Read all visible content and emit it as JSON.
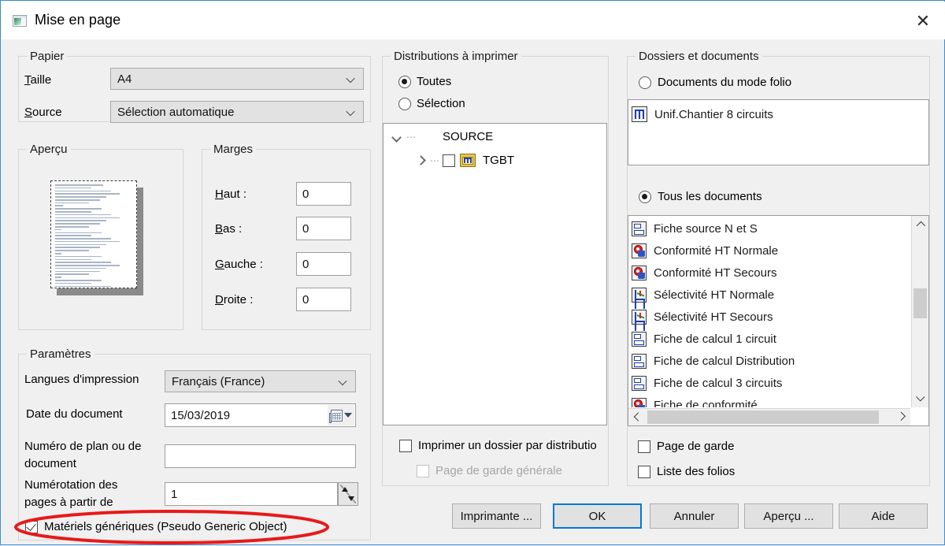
{
  "window": {
    "title": "Mise en page",
    "icon": "page-setup-icon",
    "close_label": "✕",
    "accent": "#0078d7",
    "annotation_color": "#e81919"
  },
  "papier": {
    "legend": "Papier",
    "taille_label": "Taille",
    "taille_label_accel": "T",
    "taille_value": "A4",
    "source_label": "Source",
    "source_label_accel": "S",
    "source_value": "Sélection automatique"
  },
  "apercu": {
    "legend": "Aperçu"
  },
  "marges": {
    "legend": "Marges",
    "fields": [
      {
        "label": "Haut :",
        "accel": "H",
        "value": "0"
      },
      {
        "label": "Bas :",
        "accel": "B",
        "value": "0"
      },
      {
        "label": "Gauche :",
        "accel": "G",
        "value": "0"
      },
      {
        "label": "Droite :",
        "accel": "D",
        "value": "0"
      }
    ]
  },
  "parametres": {
    "legend": "Paramètres",
    "langues_label": "Langues d'impression",
    "langues_value": "Français (France)",
    "date_label": "Date du document",
    "date_value": "15/03/2019",
    "numero_label_line1": "Numéro de plan ou de",
    "numero_label_line2": "document",
    "numero_value": "",
    "numerotation_label_line1": "Numérotation des",
    "numerotation_label_line2": "pages à partir de",
    "numerotation_value": "1",
    "materiels_label": "Matériels génériques (Pseudo Generic Object)",
    "materiels_checked": true
  },
  "distributions": {
    "legend": "Distributions à imprimer",
    "radio_toutes": "Toutes",
    "radio_selection": "Sélection",
    "selected": "Toutes",
    "tree": [
      {
        "label": "SOURCE",
        "level": 0,
        "expanded": true,
        "has_checkbox": false,
        "icon": "none"
      },
      {
        "label": "TGBT",
        "level": 1,
        "expanded": false,
        "has_checkbox": true,
        "checked": false,
        "icon": "switchboard-folder-icon"
      }
    ],
    "imprimer_dossier_label": "Imprimer un dossier par distributio",
    "imprimer_dossier_checked": false,
    "page_garde_generale_label": "Page de garde générale",
    "page_garde_generale_checked": false,
    "page_garde_generale_disabled": true
  },
  "dossiers": {
    "legend": "Dossiers et documents",
    "radio_folio": "Documents du mode folio",
    "radio_tous": "Tous les documents",
    "selected": "Tous les documents",
    "folio_items": [
      {
        "label": "Unif.Chantier 8 circuits",
        "icon": "folio-doc-icon"
      }
    ],
    "documents": [
      {
        "label": "Fiche source N et S",
        "icon": "fiche-calcul-icon"
      },
      {
        "label": "Conformité HT Normale",
        "icon": "conformite-icon"
      },
      {
        "label": "Conformité HT Secours",
        "icon": "conformite-icon"
      },
      {
        "label": "Sélectivité HT Normale",
        "icon": "selectivite-icon"
      },
      {
        "label": "Sélectivité HT Secours",
        "icon": "selectivite-icon"
      },
      {
        "label": "Fiche de calcul 1 circuit",
        "icon": "fiche-calcul-icon"
      },
      {
        "label": "Fiche de calcul Distribution",
        "icon": "fiche-calcul-icon"
      },
      {
        "label": "Fiche de calcul 3 circuits",
        "icon": "fiche-calcul-icon"
      },
      {
        "label": "Fiche de conformité",
        "icon": "conformite-icon"
      }
    ],
    "page_garde_label": "Page de garde",
    "page_garde_checked": false,
    "liste_folios_label": "Liste des folios",
    "liste_folios_checked": false
  },
  "buttons": {
    "imprimante": "Imprimante ...",
    "ok": "OK",
    "annuler": "Annuler",
    "apercu": "Aperçu ...",
    "aide": "Aide",
    "default": "OK"
  },
  "scrollbars": {
    "vertical_up": "▲",
    "vertical_down": "▼",
    "horizontal_left": "◄",
    "horizontal_right": "►"
  }
}
